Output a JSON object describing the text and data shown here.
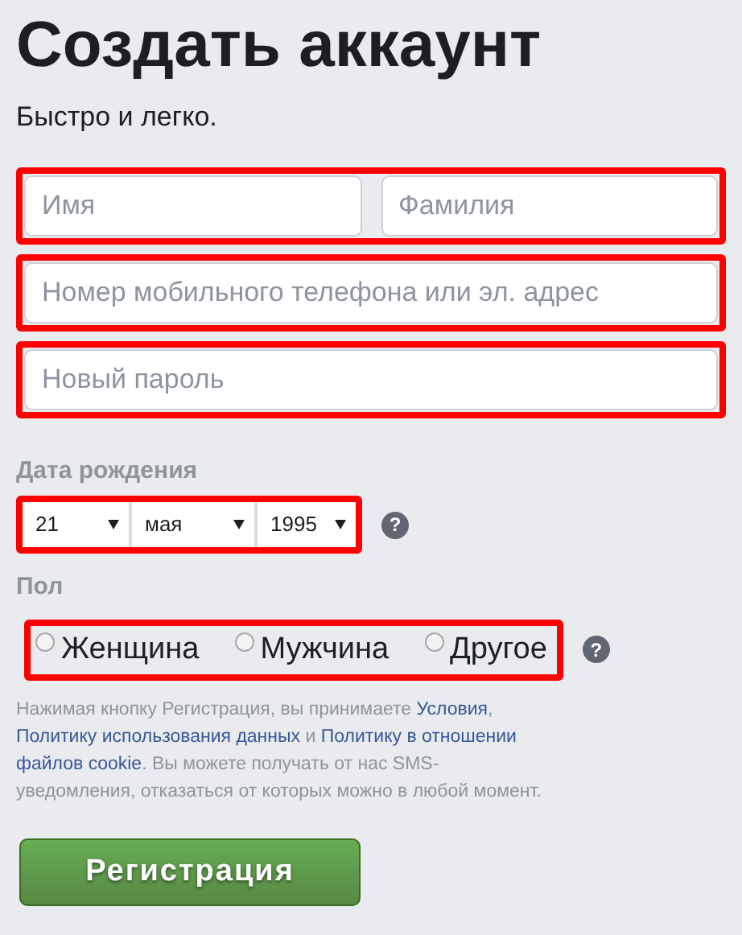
{
  "title": "Создать аккаунт",
  "subtitle": "Быстро и легко.",
  "name_fields": {
    "highlighted": true,
    "fields": [
      {
        "placeholder": "Имя"
      },
      {
        "placeholder": "Фамилия"
      }
    ]
  },
  "contact_field": {
    "highlighted": true,
    "placeholder": "Номер мобильного телефона или эл. адрес"
  },
  "password_field": {
    "highlighted": true,
    "placeholder": "Новый пароль"
  },
  "birthday": {
    "label": "Дата рождения",
    "highlighted": true,
    "selects": [
      {
        "value": "21"
      },
      {
        "value": "мая"
      },
      {
        "value": "1995"
      }
    ],
    "help": "?"
  },
  "gender": {
    "label": "Пол",
    "highlighted": true,
    "options": [
      {
        "label": "Женщина",
        "selected": false
      },
      {
        "label": "Мужчина",
        "selected": false
      },
      {
        "label": "Другое",
        "selected": false
      }
    ],
    "help": "?"
  },
  "terms": [
    [
      {
        "text": "Нажимая кнопку Регистрация, вы принимаете ",
        "link": false
      },
      {
        "text": "Условия",
        "link": true
      },
      {
        "text": ",",
        "link": false
      }
    ],
    [
      {
        "text": "Политику использования данных",
        "link": true
      },
      {
        "text": " и ",
        "link": false
      },
      {
        "text": "Политику в отношении",
        "link": true
      }
    ],
    [
      {
        "text": "файлов cookie",
        "link": true
      },
      {
        "text": ". Вы можете получать от нас SMS-",
        "link": false
      }
    ],
    [
      {
        "text": "уведомления, отказаться от которых можно в любой момент.",
        "link": false
      }
    ]
  ],
  "submit": "Регистрация"
}
